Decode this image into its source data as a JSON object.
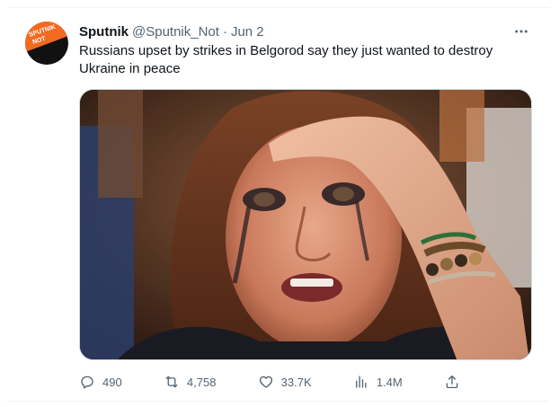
{
  "tweet": {
    "display_name": "Sputnik",
    "handle": "@Sputnik_Not",
    "separator": "·",
    "date": "Jun 2",
    "text": "Russians upset by strikes in Belgorod say they just wanted to destroy Ukraine in peace",
    "avatar_text": [
      "SPUTNIK",
      "NOT"
    ]
  },
  "actions": {
    "replies": "490",
    "retweets": "4,758",
    "likes": "33.7K",
    "views": "1.4M"
  },
  "icons": {
    "more": "more-icon",
    "reply": "reply-icon",
    "retweet": "retweet-icon",
    "like": "heart-icon",
    "views": "views-icon",
    "share": "share-icon"
  },
  "colors": {
    "avatar_orange": "#f26a21",
    "text_primary": "#0f1419",
    "text_secondary": "#536471"
  }
}
